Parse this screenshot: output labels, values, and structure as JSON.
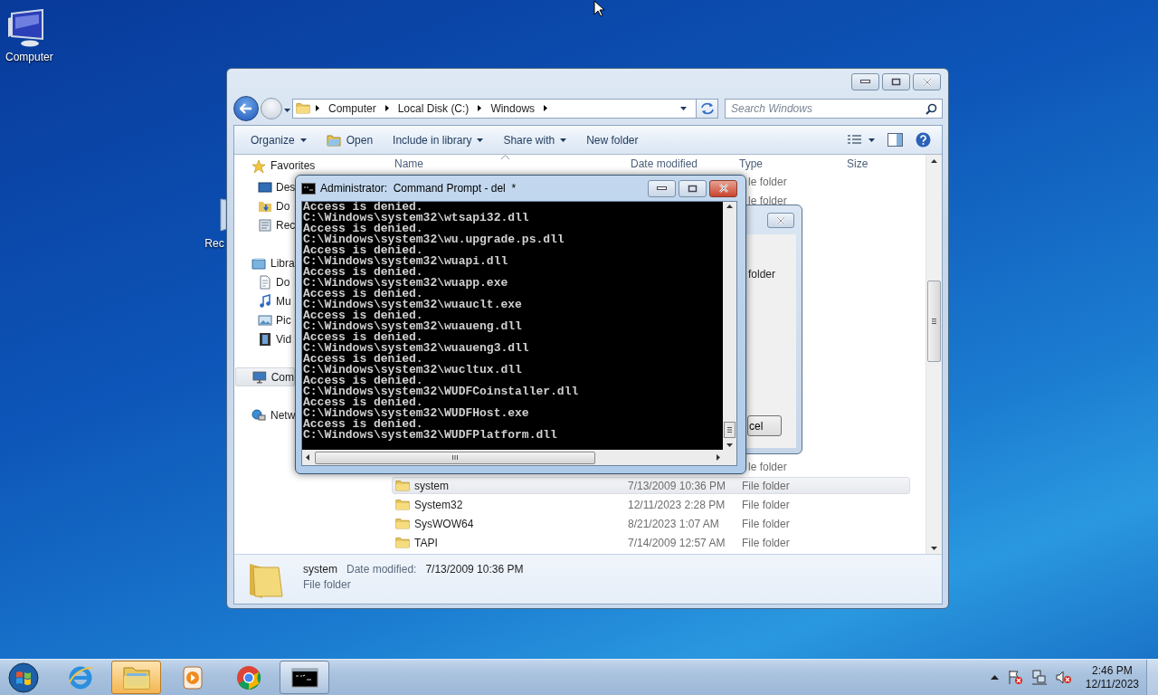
{
  "desktop_icons": [
    {
      "label": "Computer",
      "kind": "computer"
    },
    {
      "label": "Rec",
      "kind": "recycle-bin"
    }
  ],
  "explorer": {
    "breadcrumbs": [
      "Computer",
      "Local Disk (C:)",
      "Windows"
    ],
    "search": {
      "placeholder": "Search Windows"
    },
    "toolbar": [
      {
        "label": "Organize",
        "dropdown": true,
        "icon": false
      },
      {
        "label": "Open",
        "dropdown": false,
        "icon": true
      },
      {
        "label": "Include in library",
        "dropdown": true,
        "icon": false
      },
      {
        "label": "Share with",
        "dropdown": true,
        "icon": false
      },
      {
        "label": "New folder",
        "dropdown": false,
        "icon": false
      }
    ],
    "nav": [
      {
        "label": "Favorites",
        "kind": "favorites",
        "selected": false,
        "children": [
          {
            "label": "Des",
            "kind": "desktop",
            "selected": false
          },
          {
            "label": "Do",
            "kind": "downloads",
            "selected": false
          },
          {
            "label": "Rec",
            "kind": "recent",
            "selected": false
          }
        ]
      },
      {
        "label": "Libra",
        "kind": "libraries",
        "selected": false,
        "children": [
          {
            "label": "Do",
            "kind": "documents",
            "selected": false
          },
          {
            "label": "Mu",
            "kind": "music",
            "selected": false
          },
          {
            "label": "Pic",
            "kind": "pictures",
            "selected": false
          },
          {
            "label": "Vid",
            "kind": "videos",
            "selected": false
          }
        ]
      },
      {
        "label": "Com",
        "kind": "computer",
        "selected": true
      },
      {
        "label": "Netw",
        "kind": "network",
        "selected": false
      }
    ],
    "columns": [
      "Name",
      "Date modified",
      "Type",
      "Size"
    ],
    "rows": [
      {
        "kind": "partial",
        "type": "le folder",
        "selected": false
      },
      {
        "kind": "partial",
        "type": "le folder",
        "selected": false
      },
      {
        "kind": "partial",
        "type": "le folder",
        "selected": false
      },
      {
        "kind": "full",
        "name": "system",
        "date": "7/13/2009 10:36 PM",
        "type": "File folder",
        "selected": true
      },
      {
        "kind": "full",
        "name": "System32",
        "date": "12/11/2023 2:28 PM",
        "type": "File folder",
        "selected": false
      },
      {
        "kind": "full",
        "name": "SysWOW64",
        "date": "8/21/2023 1:07 AM",
        "type": "File folder",
        "selected": false
      },
      {
        "kind": "full",
        "name": "TAPI",
        "date": "7/14/2009 12:57 AM",
        "type": "File folder",
        "selected": false
      }
    ],
    "details": {
      "name": "system",
      "date_label": "Date modified:",
      "date": "7/13/2009 10:36 PM",
      "type": "File folder"
    }
  },
  "dialog": {
    "text": "folder",
    "button": "cel"
  },
  "console": {
    "title": "Administrator:  Command Prompt - del  *",
    "lines": [
      "Access is denied.",
      "C:\\Windows\\system32\\wtsapi32.dll",
      "Access is denied.",
      "C:\\Windows\\system32\\wu.upgrade.ps.dll",
      "Access is denied.",
      "C:\\Windows\\system32\\wuapi.dll",
      "Access is denied.",
      "C:\\Windows\\system32\\wuapp.exe",
      "Access is denied.",
      "C:\\Windows\\system32\\wuauclt.exe",
      "Access is denied.",
      "C:\\Windows\\system32\\wuaueng.dll",
      "Access is denied.",
      "C:\\Windows\\system32\\wuaueng3.dll",
      "Access is denied.",
      "C:\\Windows\\system32\\wucltux.dll",
      "Access is denied.",
      "C:\\Windows\\system32\\WUDFCoinstaller.dll",
      "Access is denied.",
      "C:\\Windows\\system32\\WUDFHost.exe",
      "Access is denied.",
      "C:\\Windows\\system32\\WUDFPlatform.dll"
    ]
  },
  "taskbar": {
    "apps": [
      {
        "kind": "ie",
        "open": false,
        "flashing": false
      },
      {
        "kind": "explorer",
        "open": true,
        "flashing": true
      },
      {
        "kind": "media-player",
        "open": false,
        "flashing": false
      },
      {
        "kind": "chrome",
        "open": false,
        "flashing": false
      },
      {
        "kind": "cmd",
        "open": true,
        "flashing": false
      }
    ],
    "clock": {
      "time": "2:46 PM",
      "date": "12/11/2023"
    }
  }
}
